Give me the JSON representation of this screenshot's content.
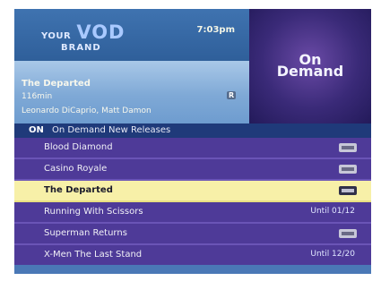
{
  "header": {
    "logo_your": "YOUR",
    "logo_vod": "VOD",
    "logo_brand": "BRAND",
    "time": "7:03pm"
  },
  "promo": {
    "line1": "On",
    "line2": "Demand"
  },
  "details": {
    "title": "The Departed",
    "duration": "116min",
    "rating": "R",
    "cast": "Leonardo DiCaprio, Matt Damon"
  },
  "category": {
    "on_label": "ON",
    "name": "On Demand New Releases"
  },
  "items": [
    {
      "label": "Blood Diamond",
      "meta": "",
      "badge": "HD"
    },
    {
      "label": "Casino Royale",
      "meta": "",
      "badge": "HD"
    },
    {
      "label": "The Departed",
      "meta": "",
      "badge": "HD",
      "selected": true
    },
    {
      "label": "Running With Scissors",
      "meta": "Until 01/12",
      "badge": ""
    },
    {
      "label": "Superman Returns",
      "meta": "",
      "badge": "HD"
    },
    {
      "label": "X-Men The Last Stand",
      "meta": "Until 12/20",
      "badge": ""
    }
  ]
}
